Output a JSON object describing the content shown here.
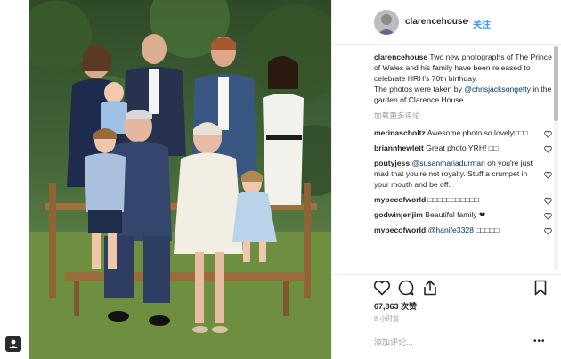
{
  "post": {
    "username": "clarencehouse",
    "dot": "•",
    "follow_label": "关注"
  },
  "caption": {
    "username": "clarencehouse",
    "text_1": "Two new photographs of The Prince of Wales and his family have been released to celebrate HRH's 70th birthday.",
    "text_2": "The photos were taken by",
    "mention": "@chrisjacksongetty",
    "text_3": "in the garden of Clarence House."
  },
  "load_more_label": "加载更多评论",
  "comments": [
    {
      "username": "merinascholtz",
      "text": "Awesome photo so lovely□□□",
      "mention": ""
    },
    {
      "username": "briannhewlett",
      "text": "Great photo YRH! □□",
      "mention": ""
    },
    {
      "username": "poutyjess",
      "mention": "@susanmariadurman",
      "text": "oh you're just mad that you're not royalty. Stuff a crumpet in your mouth and be off."
    },
    {
      "username": "mypecofworld",
      "text": "□□□□□□□□□□□",
      "mention": ""
    },
    {
      "username": "godwinjenjim",
      "text": "Beautiful family ❤",
      "mention": ""
    },
    {
      "username": "mypecofworld",
      "mention": "@hanife3328",
      "text": "□□□□□"
    }
  ],
  "actions": {
    "likes": "67,863 次赞",
    "time_ago": "8 小时前",
    "add_comment_placeholder": "添加评论...",
    "more_label": "•••"
  },
  "icons": {
    "like": "heart-icon",
    "comment": "comment-icon",
    "share": "share-icon",
    "save": "bookmark-icon",
    "corner": "user-badge-icon"
  },
  "colors": {
    "link_blue": "#3897f0",
    "mention_blue": "#003569",
    "muted_gray": "#999999",
    "text": "#262626"
  }
}
